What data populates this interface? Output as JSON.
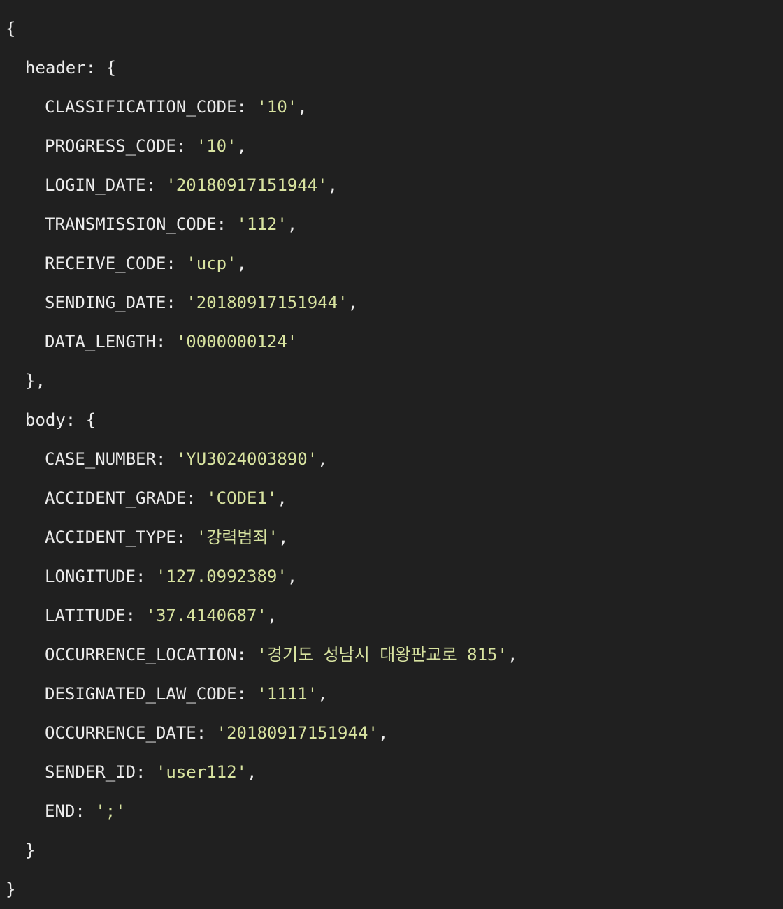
{
  "code": {
    "open_brace": "{",
    "close_brace": "}",
    "header": {
      "key": "header",
      "close": "},",
      "fields": [
        {
          "key": "CLASSIFICATION_CODE",
          "value": "'10'",
          "trail": ","
        },
        {
          "key": "PROGRESS_CODE",
          "value": "'10'",
          "trail": ","
        },
        {
          "key": "LOGIN_DATE",
          "value": "'20180917151944'",
          "trail": ","
        },
        {
          "key": "TRANSMISSION_CODE",
          "value": "'112'",
          "trail": ","
        },
        {
          "key": "RECEIVE_CODE",
          "value": "'ucp'",
          "trail": ","
        },
        {
          "key": "SENDING_DATE",
          "value": "'20180917151944'",
          "trail": ","
        },
        {
          "key": "DATA_LENGTH",
          "value": "'0000000124'",
          "trail": ""
        }
      ]
    },
    "body": {
      "key": "body",
      "close": "}",
      "fields": [
        {
          "key": "CASE_NUMBER",
          "value": "'YU3024003890'",
          "trail": ","
        },
        {
          "key": "ACCIDENT_GRADE",
          "value": "'CODE1'",
          "trail": ","
        },
        {
          "key": "ACCIDENT_TYPE",
          "value": "'강력범죄'",
          "trail": ","
        },
        {
          "key": "LONGITUDE",
          "value": "'127.0992389'",
          "trail": ","
        },
        {
          "key": "LATITUDE",
          "value": "'37.4140687'",
          "trail": ","
        },
        {
          "key": "OCCURRENCE_LOCATION",
          "value": "'경기도 성남시 대왕판교로 815'",
          "trail": ","
        },
        {
          "key": "DESIGNATED_LAW_CODE",
          "value": "'1111'",
          "trail": ","
        },
        {
          "key": "OCCURRENCE_DATE",
          "value": "'20180917151944'",
          "trail": ","
        },
        {
          "key": "SENDER_ID",
          "value": "'user112'",
          "trail": ","
        },
        {
          "key": "END",
          "value": "';'",
          "trail": ""
        }
      ]
    }
  }
}
